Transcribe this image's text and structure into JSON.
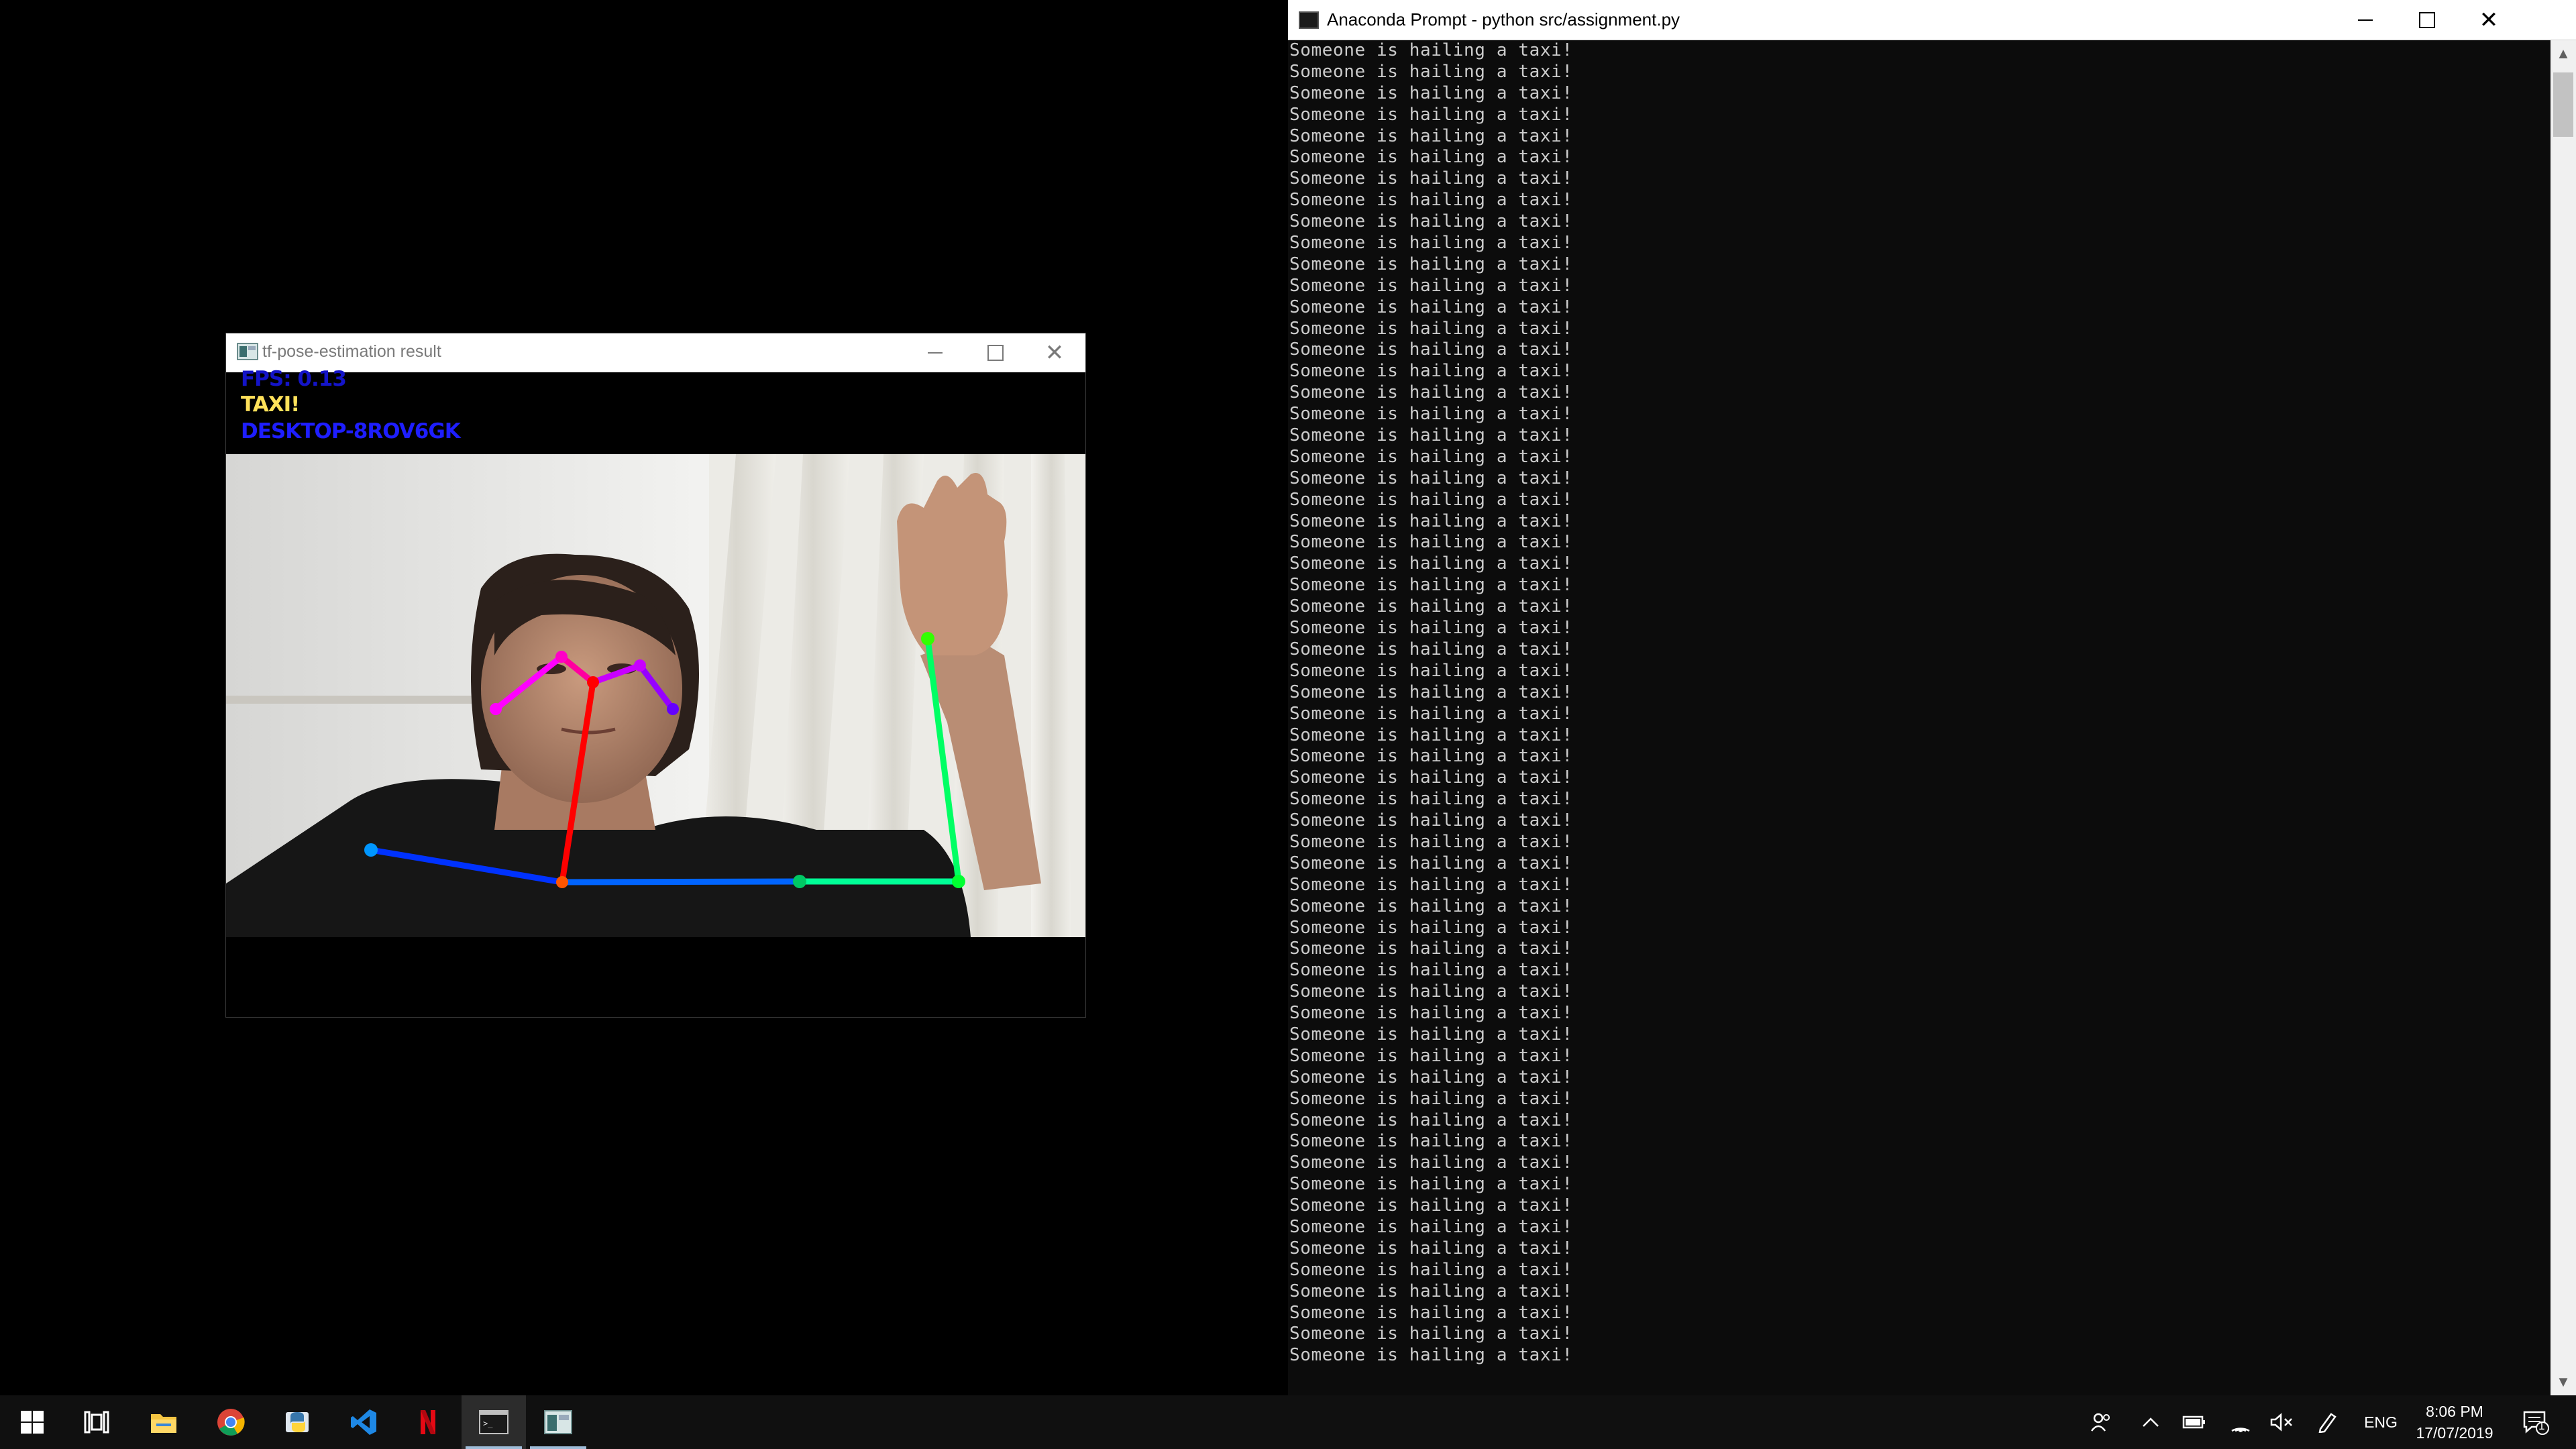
{
  "colors": {
    "desktop": "#000000",
    "console_bg": "#0c0c0c",
    "console_text": "#cccccc",
    "overlay_fps": "#1414c8",
    "overlay_taxi": "#ffe15a",
    "overlay_host": "#1e1eff",
    "taskbar": "#101010"
  },
  "console": {
    "title": "Anaconda Prompt - python  src/assignment.py",
    "line_text": "Someone is hailing a taxi!",
    "line_count": 62
  },
  "pose_window": {
    "title": "tf-pose-estimation result",
    "fps_label": "FPS: 0.13",
    "status_label": "TAXI!",
    "host_label": "DESKTOP-8ROV6GK"
  },
  "taskbar": {
    "apps": [
      {
        "name": "start",
        "icon": "windows-logo-icon"
      },
      {
        "name": "task-view",
        "icon": "task-view-icon"
      },
      {
        "name": "file-explorer",
        "icon": "folder-icon"
      },
      {
        "name": "chrome",
        "icon": "chrome-icon"
      },
      {
        "name": "python",
        "icon": "python-icon"
      },
      {
        "name": "vscode",
        "icon": "vscode-icon"
      },
      {
        "name": "netflix",
        "icon": "netflix-icon"
      },
      {
        "name": "anaconda-prompt",
        "icon": "console-icon"
      },
      {
        "name": "pose-window",
        "icon": "app-window-icon"
      }
    ],
    "language": "ENG",
    "time": "8:06 PM",
    "date": "17/07/2019",
    "notifications_count": "1"
  }
}
